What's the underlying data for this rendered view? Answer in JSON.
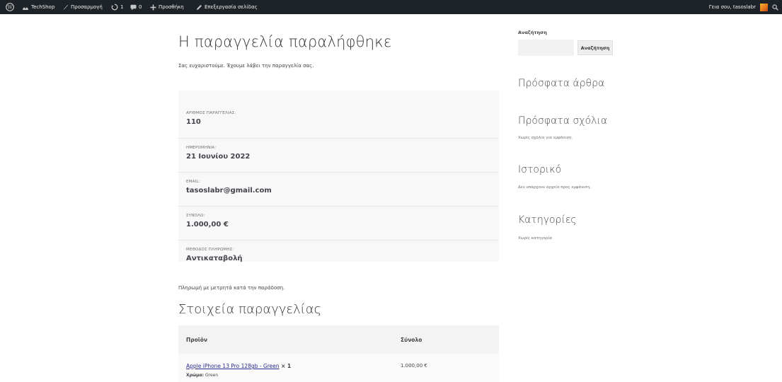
{
  "adminbar": {
    "site_name": "TechShop",
    "customize": "Προσαρμογή",
    "updates_count": "1",
    "comments_count": "0",
    "new_label": "Προσθήκη",
    "edit_label": "Επεξεργασία σελίδας",
    "greeting": "Γεια σου, tasoslabr"
  },
  "page": {
    "title": "Η παραγγελία παραλήφθηκε",
    "thanks": "Σας ευχαριστούμε. Έχουμε λάβει την παραγγελία σας."
  },
  "overview": [
    {
      "label": "ΑΡΙΘΜΟΣ ΠΑΡΑΓΓΕΛΙΑΣ:",
      "value": "110"
    },
    {
      "label": "ΗΜΕΡΟΜΗΝΙΑ:",
      "value": "21 Ιουνίου 2022"
    },
    {
      "label": "EMAIL:",
      "value": "tasoslabr@gmail.com"
    },
    {
      "label": "ΣΥΝΟΛΟ:",
      "value": "1.000,00 €"
    },
    {
      "label": "ΜΕΘΟΔΟΣ ΠΛΗΡΩΜΗΣ:",
      "value": "Αντικαταβολή"
    }
  ],
  "payment_note": "Πληρωμή με μετρητά κατά την παράδοση.",
  "details": {
    "title": "Στοιχεία παραγγελίας",
    "col_product": "Προϊόν",
    "col_total": "Σύνολο",
    "items": [
      {
        "name": "Apple iPhone 13 Pro 128gb - Green",
        "qty": "× 1",
        "meta_label": "Χρώμα:",
        "meta_value": "Green",
        "total": "1.000,00 €"
      }
    ]
  },
  "sidebar": {
    "search_label": "Αναζήτηση",
    "search_button": "Αναζήτηση",
    "recent_posts": "Πρόσφατα άρθρα",
    "recent_comments": "Πρόσφατα σχόλια",
    "recent_comments_text": "Χωρίς σχόλια για εμφάνιση.",
    "archives": "Ιστορικό",
    "archives_text": "Δεν υπάρχουν αρχεία προς εμφάνιση.",
    "categories": "Κατηγορίες",
    "categories_text": "Χωρίς κατηγορία"
  }
}
